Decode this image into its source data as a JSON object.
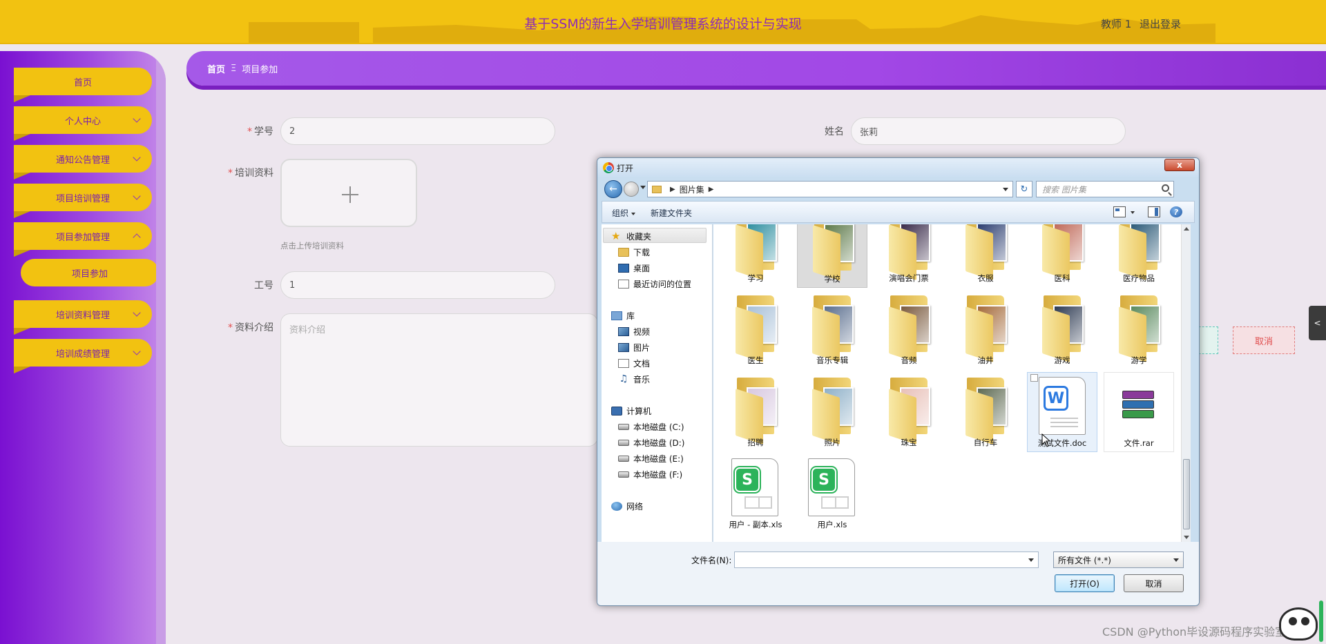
{
  "header": {
    "title": "基于SSM的新生入学培训管理系统的设计与实现",
    "user": "教师 1",
    "logout": "退出登录"
  },
  "sidebar": {
    "items": [
      {
        "label": "首页"
      },
      {
        "label": "个人中心"
      },
      {
        "label": "通知公告管理"
      },
      {
        "label": "项目培训管理"
      },
      {
        "label": "项目参加管理"
      },
      {
        "label": "项目参加"
      },
      {
        "label": "培训资料管理"
      },
      {
        "label": "培训成绩管理"
      }
    ]
  },
  "breadcrumb": {
    "home": "首页",
    "separator": "Ξ",
    "current": "项目参加"
  },
  "form": {
    "student_no_label": "学号",
    "student_no_value": "2",
    "name_label": "姓名",
    "name_value": "张莉",
    "material_label": "培训资料",
    "upload_hint": "点击上传培训资料",
    "work_no_label": "工号",
    "work_no_value": "1",
    "intro_label": "资料介绍",
    "intro_placeholder": "资料介绍",
    "cancel": "取消",
    "required_mark": "*"
  },
  "side_tab": {
    "label": "<"
  },
  "dialog": {
    "title": "打开",
    "close": "x",
    "path": "图片集",
    "search_placeholder": "搜索 图片集",
    "toolbar": {
      "organize": "组织",
      "new_folder": "新建文件夹",
      "help": "?"
    },
    "nav": {
      "favorites": "收藏夹",
      "downloads": "下载",
      "desktop": "桌面",
      "recent": "最近访问的位置",
      "library": "库",
      "videos": "视频",
      "pictures": "图片",
      "documents": "文档",
      "music": "音乐",
      "computer": "计算机",
      "drives": [
        "本地磁盘 (C:)",
        "本地磁盘 (D:)",
        "本地磁盘 (E:)",
        "本地磁盘 (F:)"
      ],
      "network": "网络"
    },
    "files": [
      {
        "name": "学习",
        "kind": "folder",
        "color": "#2f8fa0"
      },
      {
        "name": "学校",
        "kind": "folder",
        "color": "#5e7a4a"
      },
      {
        "name": "演唱会门票",
        "kind": "folder",
        "color": "#3a2b4a"
      },
      {
        "name": "衣服",
        "kind": "folder",
        "color": "#2c3e70"
      },
      {
        "name": "医科",
        "kind": "folder",
        "color": "#c06a5a"
      },
      {
        "name": "医疗物品",
        "kind": "folder",
        "color": "#2b5a78"
      },
      {
        "name": "医生",
        "kind": "folder",
        "color": "#a8c0d8"
      },
      {
        "name": "音乐专辑",
        "kind": "folder",
        "color": "#5a6e8e"
      },
      {
        "name": "音频",
        "kind": "folder",
        "color": "#7a5a3e"
      },
      {
        "name": "油井",
        "kind": "folder",
        "color": "#a46a3a"
      },
      {
        "name": "游戏",
        "kind": "folder",
        "color": "#2d3a52"
      },
      {
        "name": "游学",
        "kind": "folder",
        "color": "#5a8a5e"
      },
      {
        "name": "招聘",
        "kind": "folder",
        "color": "#d8c8e0"
      },
      {
        "name": "照片",
        "kind": "folder",
        "color": "#8eb0c8"
      },
      {
        "name": "珠宝",
        "kind": "folder",
        "color": "#e8c0b8"
      },
      {
        "name": "自行车",
        "kind": "folder",
        "color": "#5e6a52"
      },
      {
        "name": "测试文件.doc",
        "kind": "doc"
      },
      {
        "name": "文件.rar",
        "kind": "rar"
      },
      {
        "name": "用户 - 副本.xls",
        "kind": "xls"
      },
      {
        "name": "用户.xls",
        "kind": "xls"
      }
    ],
    "filename_label": "文件名(N):",
    "filename_value": "",
    "filetype": "所有文件 (*.*)",
    "open": "打开(O)",
    "cancel": "取消"
  },
  "watermark": "CSDN @Python毕设源码程序实验室"
}
